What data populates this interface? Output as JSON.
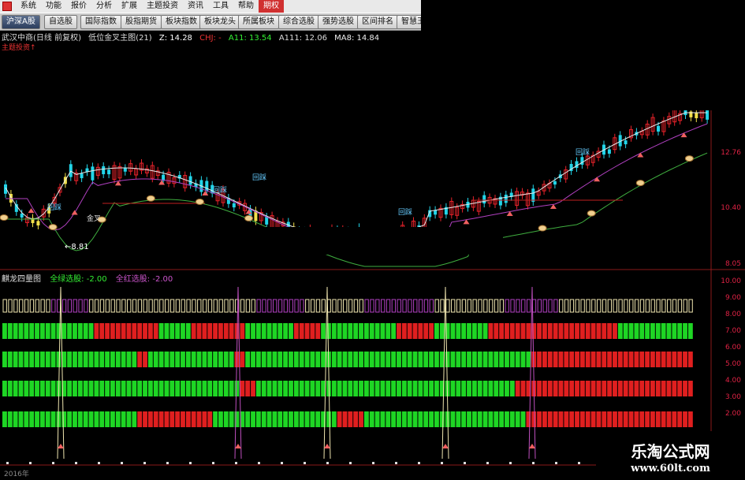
{
  "menu": {
    "items": [
      "系统",
      "功能",
      "报价",
      "分析",
      "扩展",
      "主题投资",
      "资讯",
      "工具",
      "帮助",
      "期权"
    ],
    "active_index": 9
  },
  "toolbar": {
    "buttons": [
      "沪深A股",
      "自选股",
      "国际指数",
      "股指期货",
      "板块指数",
      "板块龙头",
      "所属板块",
      "综合选股",
      "强势选股",
      "区间排名",
      "智慧王"
    ]
  },
  "info_line": {
    "stock": "武汉中商(日线 前复权)",
    "indicator": "低位金叉主图(21)",
    "z": "Z: 14.28",
    "chji": "CHJ: -",
    "a11": "A11: 13.54",
    "a111": "A111: 12.06",
    "ma8": "MA8: 14.84"
  },
  "sub_label": "主题投资↑",
  "main_axis": [
    "12.76",
    "10.40",
    "8.05"
  ],
  "annotations": {
    "low_price": "8.81",
    "cross_label": "金叉",
    "buy_label": "回踩"
  },
  "bottom_panel": {
    "title": "麒龙四量图",
    "green_label": "全绿选股: -2.00",
    "red_label": "全红选股: -2.00",
    "axis": [
      "10.00",
      "9.00",
      "8.00",
      "7.00",
      "6.00",
      "5.00",
      "4.00",
      "3.00",
      "2.00"
    ]
  },
  "footer": {
    "year": "2016年"
  },
  "watermark": {
    "line1": "乐淘公式网",
    "line2": "www.60lt.com"
  },
  "colors": {
    "up": "#e8222a",
    "down": "#22d4e8",
    "green": "#1ed624",
    "red": "#e01f1f",
    "purple": "#b040c0"
  }
}
